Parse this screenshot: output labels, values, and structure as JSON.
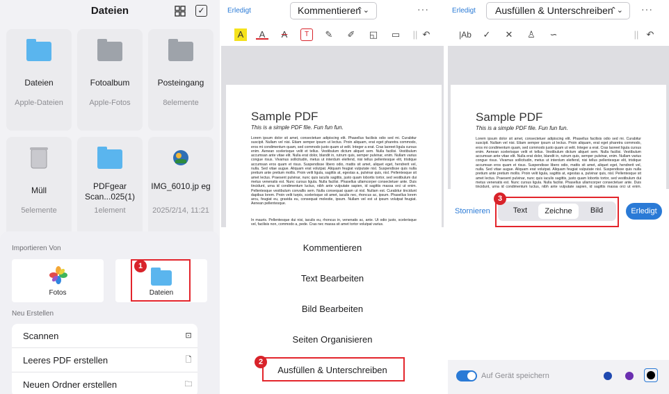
{
  "panel1": {
    "title": "Dateien",
    "tiles": [
      {
        "name": "Dateien",
        "sub": "Apple-Dateien"
      },
      {
        "name": "Fotoalbum",
        "sub": "Apple-Fotos"
      },
      {
        "name": "Posteingang",
        "sub": "8elemente"
      },
      {
        "name": "Müll",
        "sub": "5elemente"
      },
      {
        "name": "PDFgear Scan...025(1)",
        "sub": "1element"
      },
      {
        "name": "IMG_6010.jp eg",
        "sub": "2025/2/14, 11:21"
      }
    ],
    "import_label": "Importieren Von",
    "import_fotos": "Fotos",
    "import_dateien": "Dateien",
    "new_label": "Neu Erstellen",
    "list": [
      "Scannen",
      "Leeres PDF erstellen",
      "Neuen Ordner erstellen"
    ],
    "badge": "1"
  },
  "panel2": {
    "done": "Erledigt",
    "mode": "Kommentieren",
    "more": "···",
    "doc_title": "Sample PDF",
    "doc_sub": "This is a simple PDF file. Fun fun fun.",
    "doc_body": "Lorem ipsum dolor sit amet, consectetuer adipiscing elit. Phasellus facilisis odio sed mi. Curabitur suscipit. Nullam vel nisi. Etiam semper ipsum ut lectus. Proin aliquam, erat eget pharetra commodo, eros mi condimentum quam, sed commodo justo quam ut velit. Integer a erat. Cras laoreet ligula cursus enim. Aenean scelerisque velit et tellus. Vestibulum dictum aliquet sem. Nulla facilisi. Vestibulum accumsan ante vitae elit. Nulla erat dolor, blandit in, rutrum quis, semper pulvinar, enim. Nullam varius congue risus. Vivamus sollicitudin, metus ut interdum eleifend, nisi tellus pellentesque elit, tristique accumsan eros quam et risus. Suspendisse libero odio, mattis sit amet, aliquet eget, hendrerit vel, nulla. Sed vitae augue. Aliquam erat volutpat. Aliquam feugiat vulputate nisl. Suspendisse quis nulla pretium ante pretium mollis. Proin velit ligula, sagittis at, egestas a, pulvinar quis, nisl. Pellentesque sit amet lectus. Praesent pulvinar, nunc quis iaculis sagittis, justo quam lobortis tortor, sed vestibulum dui metus venenatis est. Nunc cursus ligula. Nulla facilisi. Phasellus ullamcorper consectetuer ante. Duis tincidunt, urna id condimentum luctus, nibh ante vulputate sapien, id sagittis massa orci ut enim. Pellentesque vestibulum convallis sem. Nulla consequat quam ut nisl. Nullam est. Curabitur tincidunt dapibus lorem. Proin velit turpis, scelerisque sit amet, iaculis nec, rhoncus ac, ipsum. Phasellus lorem arcu, feugiat eu, gravida eu, consequat molestie, ipsum. Nullam vel est ut ipsum volutpat feugiat. Aenean pellentesque.",
    "doc_body2": "In mauris. Pellentesque dui nisi, iaculis eu, rhoncus in, venenatis ac, ante. Ut odio justo, scelerisque vel, facilisis non, commodo a, pede. Cras nec massa sit amet tortor volutpat varius.",
    "menu": [
      "Kommentieren",
      "Text Bearbeiten",
      "Bild Bearbeiten",
      "Seiten Organisieren",
      "Ausfüllen & Unterschreiben"
    ],
    "badge": "2"
  },
  "panel3": {
    "done": "Erledigt",
    "mode": "Ausfüllen & Unterschreiben",
    "more": "···",
    "tool_text": "|Ab",
    "doc_title": "Sample PDF",
    "doc_sub": "This is a simple PDF file. Fun fun fun.",
    "cancel": "Stornieren",
    "seg": [
      "Text",
      "Zeichne",
      "Bild"
    ],
    "done_btn": "Erledigt",
    "save_label": "Auf Gerät speichern",
    "badge": "3",
    "colors": [
      "#1f49b0",
      "#6a2fb0",
      "#000000"
    ]
  }
}
